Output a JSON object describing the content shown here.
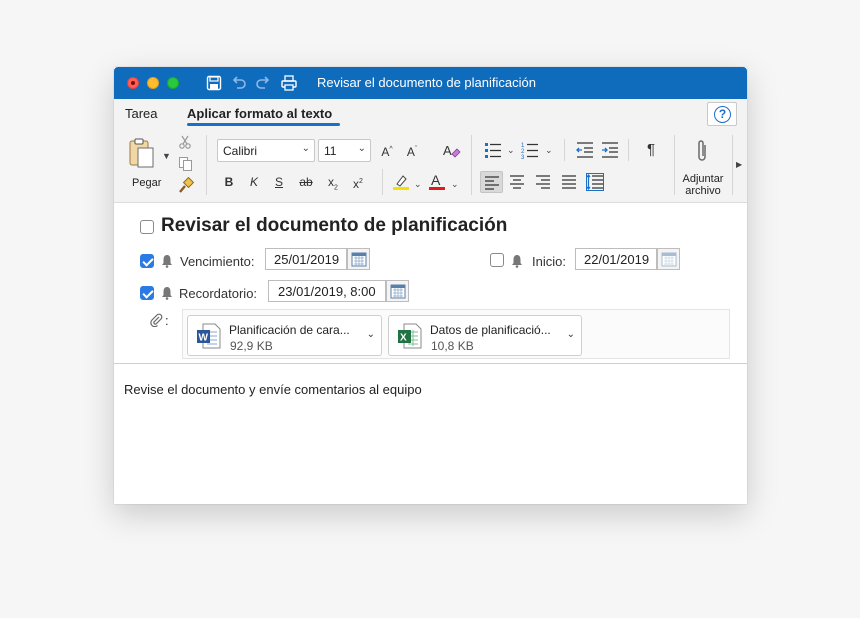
{
  "window": {
    "title": "Revisar el documento de planificación",
    "accent_color": "#0f6cbd"
  },
  "titlebar_icons": [
    "save-icon",
    "undo-icon",
    "redo-icon",
    "print-icon"
  ],
  "tabs": [
    {
      "label": "Tarea",
      "active": false
    },
    {
      "label": "Aplicar formato al texto",
      "active": true
    }
  ],
  "help": {
    "label": "?"
  },
  "ribbon": {
    "paste_label": "Pegar",
    "font_name": "Calibri",
    "font_size": "11",
    "bold_label": "B",
    "italic_label": "K",
    "underline_label": "S",
    "strike_label": "ab",
    "subscript_label": "x",
    "superscript_label": "x",
    "attach_label_1": "Adjuntar",
    "attach_label_2": "archivo",
    "highlight_color": "#f5e000",
    "font_color": "#e01b1b"
  },
  "task": {
    "title": "Revisar el documento de planificación",
    "completed": false,
    "due_label": "Vencimiento:",
    "due_value": "25/01/2019",
    "due_checked": true,
    "start_label": "Inicio:",
    "start_value": "22/01/2019",
    "start_checked": false,
    "reminder_label": "Recordatorio:",
    "reminder_value": "23/01/2019, 8:00",
    "reminder_checked": true,
    "attach_label": ":"
  },
  "attachments": [
    {
      "name": "Planificación de cara...",
      "size": "92,9 KB",
      "type": "word",
      "color": "#2b579a"
    },
    {
      "name": "Datos de planificació...",
      "size": "10,8 KB",
      "type": "excel",
      "color": "#217346"
    }
  ],
  "body": {
    "text": "Revise el documento y envíe comentarios al equipo"
  }
}
